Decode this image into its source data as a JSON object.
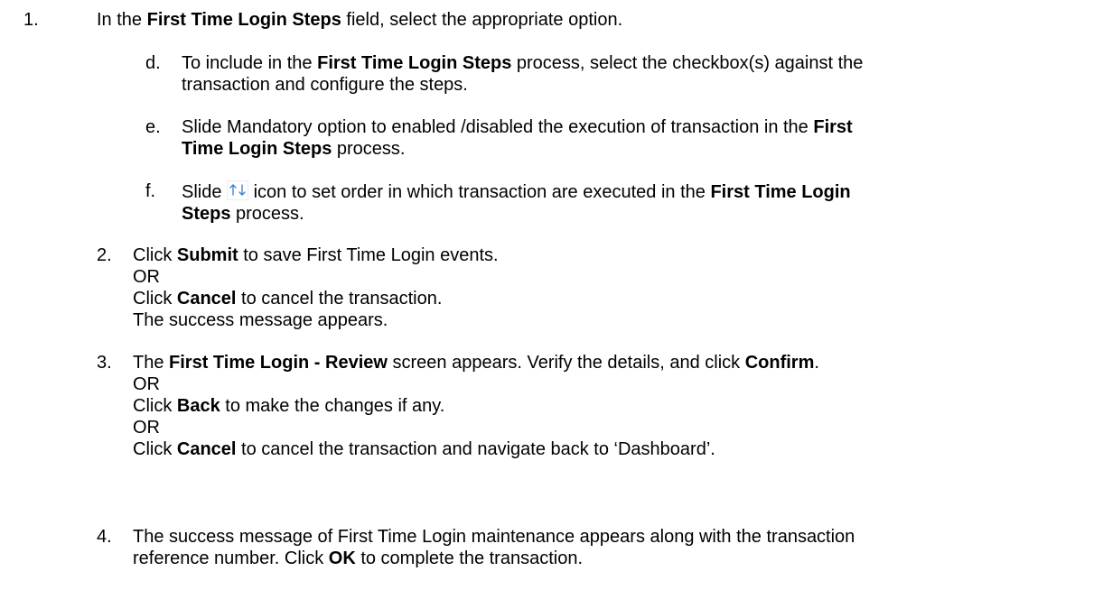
{
  "step1": {
    "number": "1.",
    "t1": "In the ",
    "b1": "First Time Login Steps",
    "t2": " field, select the appropriate option."
  },
  "step_d": {
    "letter": "d.",
    "t1": "To include in the ",
    "b1": "First Time Login Steps",
    "t2": " process, select the checkbox(s) against the",
    "line2": "transaction and configure the steps."
  },
  "step_e": {
    "letter": "e.",
    "t1": "Slide Mandatory option to enabled /disabled the execution of transaction in the ",
    "b1": "First",
    "b2": "Time Login Steps",
    "t2": " process."
  },
  "step_f": {
    "letter": "f.",
    "t1": "Slide ",
    "t2": " icon to set order in which transaction are executed in the ",
    "b1": "First Time Login",
    "b2": "Steps",
    "t3": " process.",
    "icon": "up-down-arrows-icon",
    "icon_color": "#2f7fd1"
  },
  "step2": {
    "number": "2.",
    "t1": "Click ",
    "b1": "Submit",
    "t2": " to save First Time Login events.",
    "or": "OR",
    "t3": "Click ",
    "b2": "Cancel",
    "t4": " to cancel the transaction.",
    "line4": "The success message appears."
  },
  "step3": {
    "number": "3.",
    "t1": "The ",
    "b1": "First Time Login - Review",
    "t2": " screen appears. Verify the details, and click ",
    "b2": "Confirm",
    "t3": ".",
    "or1": "OR",
    "t4": "Click ",
    "b3": "Back",
    "t5": " to make the changes if any.",
    "or2": "OR",
    "t6": "Click ",
    "b4": "Cancel",
    "t7": " to cancel the transaction and navigate back to ‘Dashboard’."
  },
  "step4": {
    "number": "4.",
    "line1": "The success message of First Time Login maintenance appears along with the transaction",
    "t1": "reference number. Click ",
    "b1": "OK",
    "t2": " to complete the transaction."
  }
}
